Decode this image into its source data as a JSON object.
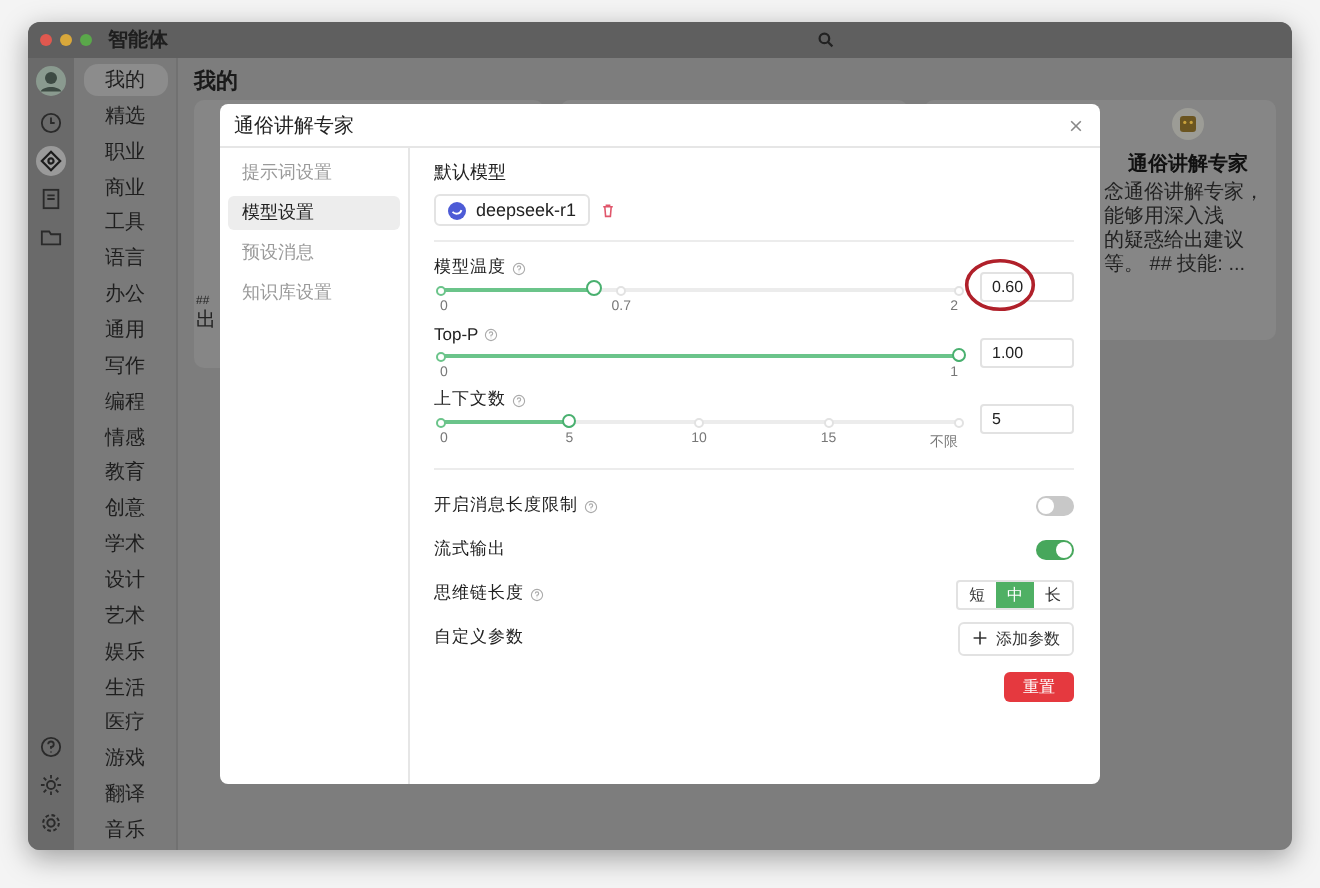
{
  "window": {
    "title": "智能体"
  },
  "rail": {
    "top": [
      {
        "kind": "clock",
        "selected": false
      },
      {
        "kind": "diamond",
        "selected": true
      },
      {
        "kind": "book",
        "selected": false
      },
      {
        "kind": "folder",
        "selected": false
      }
    ],
    "bottom": [
      {
        "kind": "help"
      },
      {
        "kind": "sun"
      },
      {
        "kind": "gear"
      }
    ]
  },
  "categories": [
    {
      "label": "我的",
      "selected": true
    },
    {
      "label": "精选",
      "selected": false
    },
    {
      "label": "职业",
      "selected": false
    },
    {
      "label": "商业",
      "selected": false
    },
    {
      "label": "工具",
      "selected": false
    },
    {
      "label": "语言",
      "selected": false
    },
    {
      "label": "办公",
      "selected": false
    },
    {
      "label": "通用",
      "selected": false
    },
    {
      "label": "写作",
      "selected": false
    },
    {
      "label": "编程",
      "selected": false
    },
    {
      "label": "情感",
      "selected": false
    },
    {
      "label": "教育",
      "selected": false
    },
    {
      "label": "创意",
      "selected": false
    },
    {
      "label": "学术",
      "selected": false
    },
    {
      "label": "设计",
      "selected": false
    },
    {
      "label": "艺术",
      "selected": false
    },
    {
      "label": "娱乐",
      "selected": false
    },
    {
      "label": "生活",
      "selected": false
    },
    {
      "label": "医疗",
      "selected": false
    },
    {
      "label": "游戏",
      "selected": false
    },
    {
      "label": "翻译",
      "selected": false
    },
    {
      "label": "音乐",
      "selected": false
    }
  ],
  "page_title": "我的",
  "left_card": {
    "lines": [
      "##",
      "出"
    ]
  },
  "right_card": {
    "title": "通俗讲解专家",
    "lines": [
      "念通俗讲解专家，能够用深入浅",
      "的疑惑给出建议等。 ## 技能: ..."
    ]
  },
  "modal": {
    "title": "通俗讲解专家",
    "nav": [
      {
        "label": "提示词设置",
        "selected": false
      },
      {
        "label": "模型设置",
        "selected": true
      },
      {
        "label": "预设消息",
        "selected": false
      },
      {
        "label": "知识库设置",
        "selected": false
      }
    ],
    "model_label": "默认模型",
    "model": "deepseek-r1",
    "sliders": [
      {
        "label": "模型温度",
        "help": true,
        "level": 0.3,
        "marks": [
          "0",
          "0.7",
          "2"
        ],
        "value": "0.60",
        "annotated": true
      },
      {
        "label": "Top-P",
        "help": true,
        "level": 1,
        "marks": [
          "0",
          "1"
        ],
        "value": "1.00",
        "annotated": false
      },
      {
        "label": "上下文数",
        "help": true,
        "level": 0.25,
        "marks": [
          "0",
          "5",
          "10",
          "15",
          "不限"
        ],
        "value": "5",
        "annotated": false
      }
    ],
    "rows": [
      {
        "kind": "toggle",
        "label": "开启消息长度限制",
        "help": true,
        "on": false
      },
      {
        "kind": "toggle",
        "label": "流式输出",
        "help": false,
        "on": true
      },
      {
        "kind": "segmented",
        "label": "思维链长度",
        "help": true,
        "options": [
          {
            "label": "短",
            "selected": false
          },
          {
            "label": "中",
            "selected": true
          },
          {
            "label": "长",
            "selected": false
          }
        ]
      },
      {
        "kind": "button",
        "label": "自定义参数",
        "help": false,
        "button": "添加参数"
      }
    ],
    "reset": "重置"
  }
}
